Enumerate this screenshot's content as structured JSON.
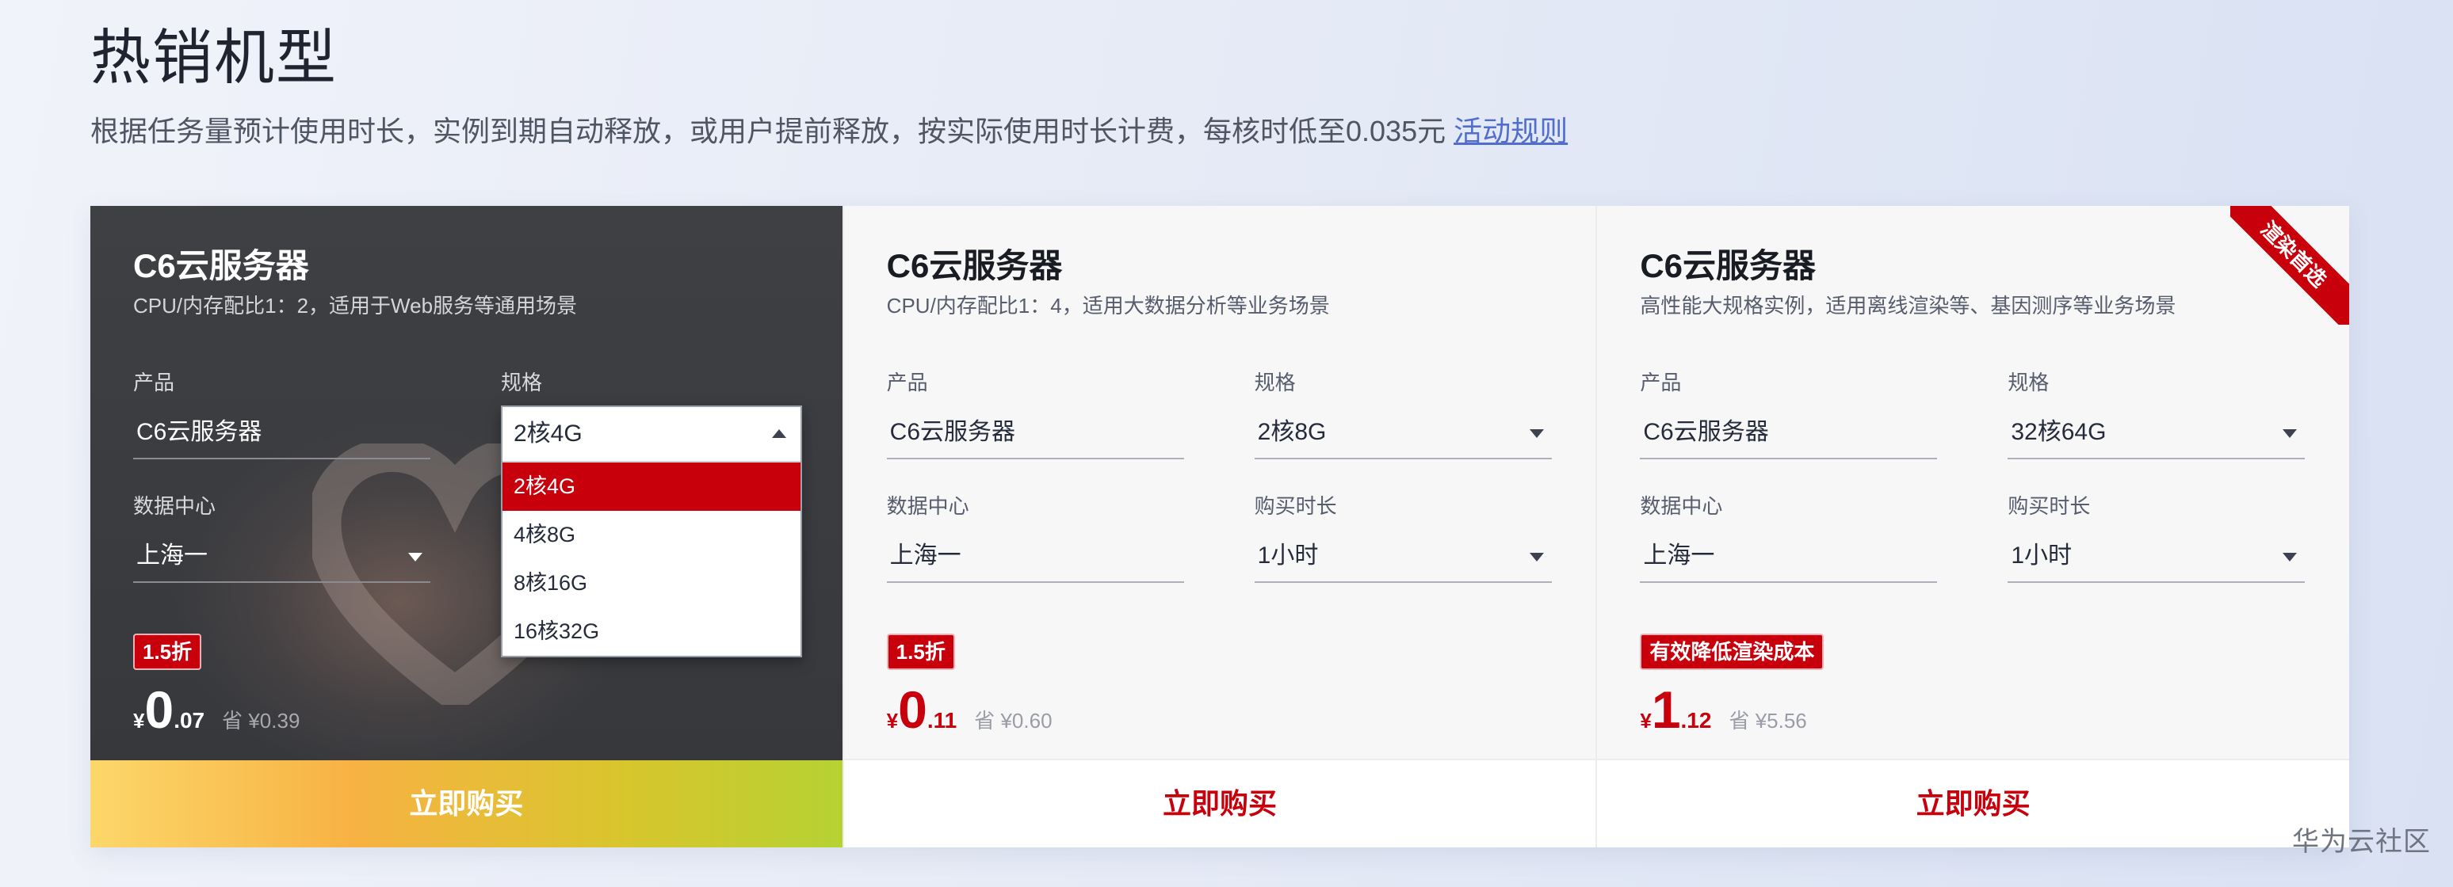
{
  "section": {
    "title": "热销机型",
    "description": "根据任务量预计使用时长，实例到期自动释放，或用户提前释放，按实际使用时长计费，每核时低至0.035元",
    "rules_link": "活动规则"
  },
  "cards": [
    {
      "title": "C6云服务器",
      "subtitle": "CPU/内存配比1：2，适用于Web服务等通用场景",
      "product_label": "产品",
      "product_value": "C6云服务器",
      "spec_label": "规格",
      "spec_value": "2核4G",
      "dc_label": "数据中心",
      "dc_value": "上海一",
      "badge": "1.5折",
      "price_currency": "¥",
      "price_int": "0",
      "price_dec": ".07",
      "price_save": "省 ¥0.39",
      "buy_label": "立即购买",
      "spec_dropdown": {
        "selected": "2核4G",
        "options": [
          "2核4G",
          "4核8G",
          "8核16G",
          "16核32G"
        ]
      }
    },
    {
      "title": "C6云服务器",
      "subtitle": "CPU/内存配比1：4，适用大数据分析等业务场景",
      "product_label": "产品",
      "product_value": "C6云服务器",
      "spec_label": "规格",
      "spec_value": "2核8G",
      "dc_label": "数据中心",
      "dc_value": "上海一",
      "duration_label": "购买时长",
      "duration_value": "1小时",
      "badge": "1.5折",
      "price_currency": "¥",
      "price_int": "0",
      "price_dec": ".11",
      "price_save": "省 ¥0.60",
      "buy_label": "立即购买"
    },
    {
      "title": "C6云服务器",
      "subtitle": "高性能大规格实例，适用离线渲染等、基因测序等业务场景",
      "ribbon": "渲染首选",
      "product_label": "产品",
      "product_value": "C6云服务器",
      "spec_label": "规格",
      "spec_value": "32核64G",
      "dc_label": "数据中心",
      "dc_value": "上海一",
      "duration_label": "购买时长",
      "duration_value": "1小时",
      "badge": "有效降低渲染成本",
      "price_currency": "¥",
      "price_int": "1",
      "price_dec": ".12",
      "price_save": "省 ¥5.56",
      "buy_label": "立即购买"
    }
  ],
  "watermark": "华为云社区",
  "colors": {
    "accent_red": "#c7000b",
    "link_blue": "#526ecc",
    "dark_card": "#3a3c40"
  },
  "icons": [
    "dropdown-caret-icon",
    "heart-image"
  ]
}
